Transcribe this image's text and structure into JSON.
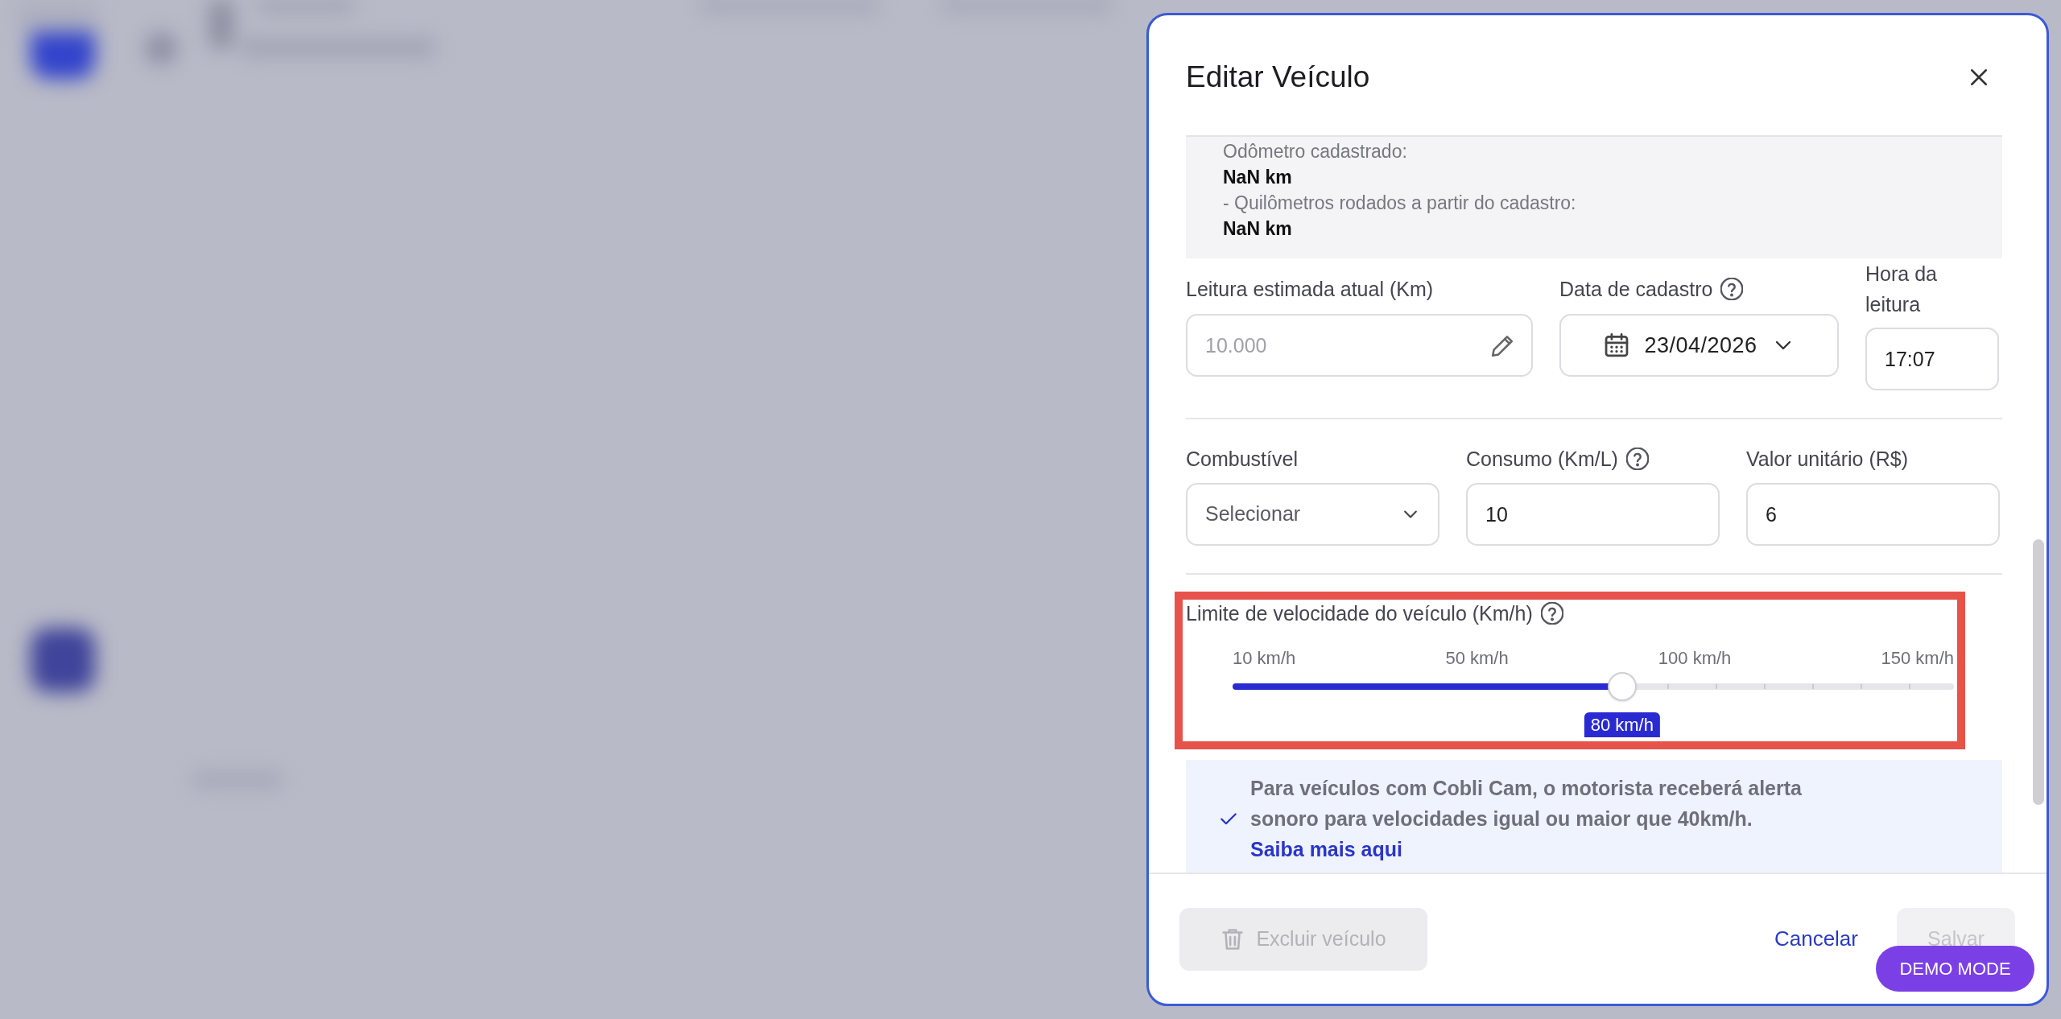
{
  "modal": {
    "title": "Editar Veículo"
  },
  "odometer_summary": [
    {
      "kind": "label",
      "text": "Odômetro cadastrado:"
    },
    {
      "kind": "value",
      "text": "NaN km"
    },
    {
      "kind": "label",
      "text": "- Quilômetros rodados a partir do cadastro:"
    },
    {
      "kind": "value",
      "text": "NaN km"
    }
  ],
  "reading_row": [
    {
      "kind": "text",
      "label": "Leitura estimada atual (Km)",
      "help": false,
      "placeholder": "10.000"
    },
    {
      "kind": "date",
      "label": "Data de cadastro",
      "help": true,
      "value": "23/04/2026"
    },
    {
      "kind": "time",
      "label": "Hora da leitura",
      "help": false,
      "value": "17:07"
    }
  ],
  "fuel_row": [
    {
      "kind": "select",
      "label": "Combustível",
      "help": false,
      "placeholder": "Selecionar"
    },
    {
      "kind": "number",
      "label": "Consumo (Km/L)",
      "help": true,
      "value": "10"
    },
    {
      "kind": "number",
      "label": "Valor unitário (R$)",
      "help": false,
      "value": "6"
    }
  ],
  "speed_limit": {
    "label": "Limite de velocidade do veículo (Km/h)",
    "help": true,
    "ticks": [
      "10 km/h",
      "50 km/h",
      "100 km/h",
      "150 km/h"
    ],
    "level": 0.54,
    "reading": "80 km/h"
  },
  "info": {
    "text": "Para veículos com Cobli Cam, o motorista receberá alerta sonoro para velocidades igual ou maior que 40km/h.",
    "link": "Saiba mais aqui"
  },
  "footer": {
    "delete_button": {
      "label": "Excluir veículo",
      "disabled": true
    },
    "cancel_link": "Cancelar",
    "save_button": {
      "label": "Salvar",
      "disabled": true
    }
  },
  "demo_badge": "DEMO MODE"
}
